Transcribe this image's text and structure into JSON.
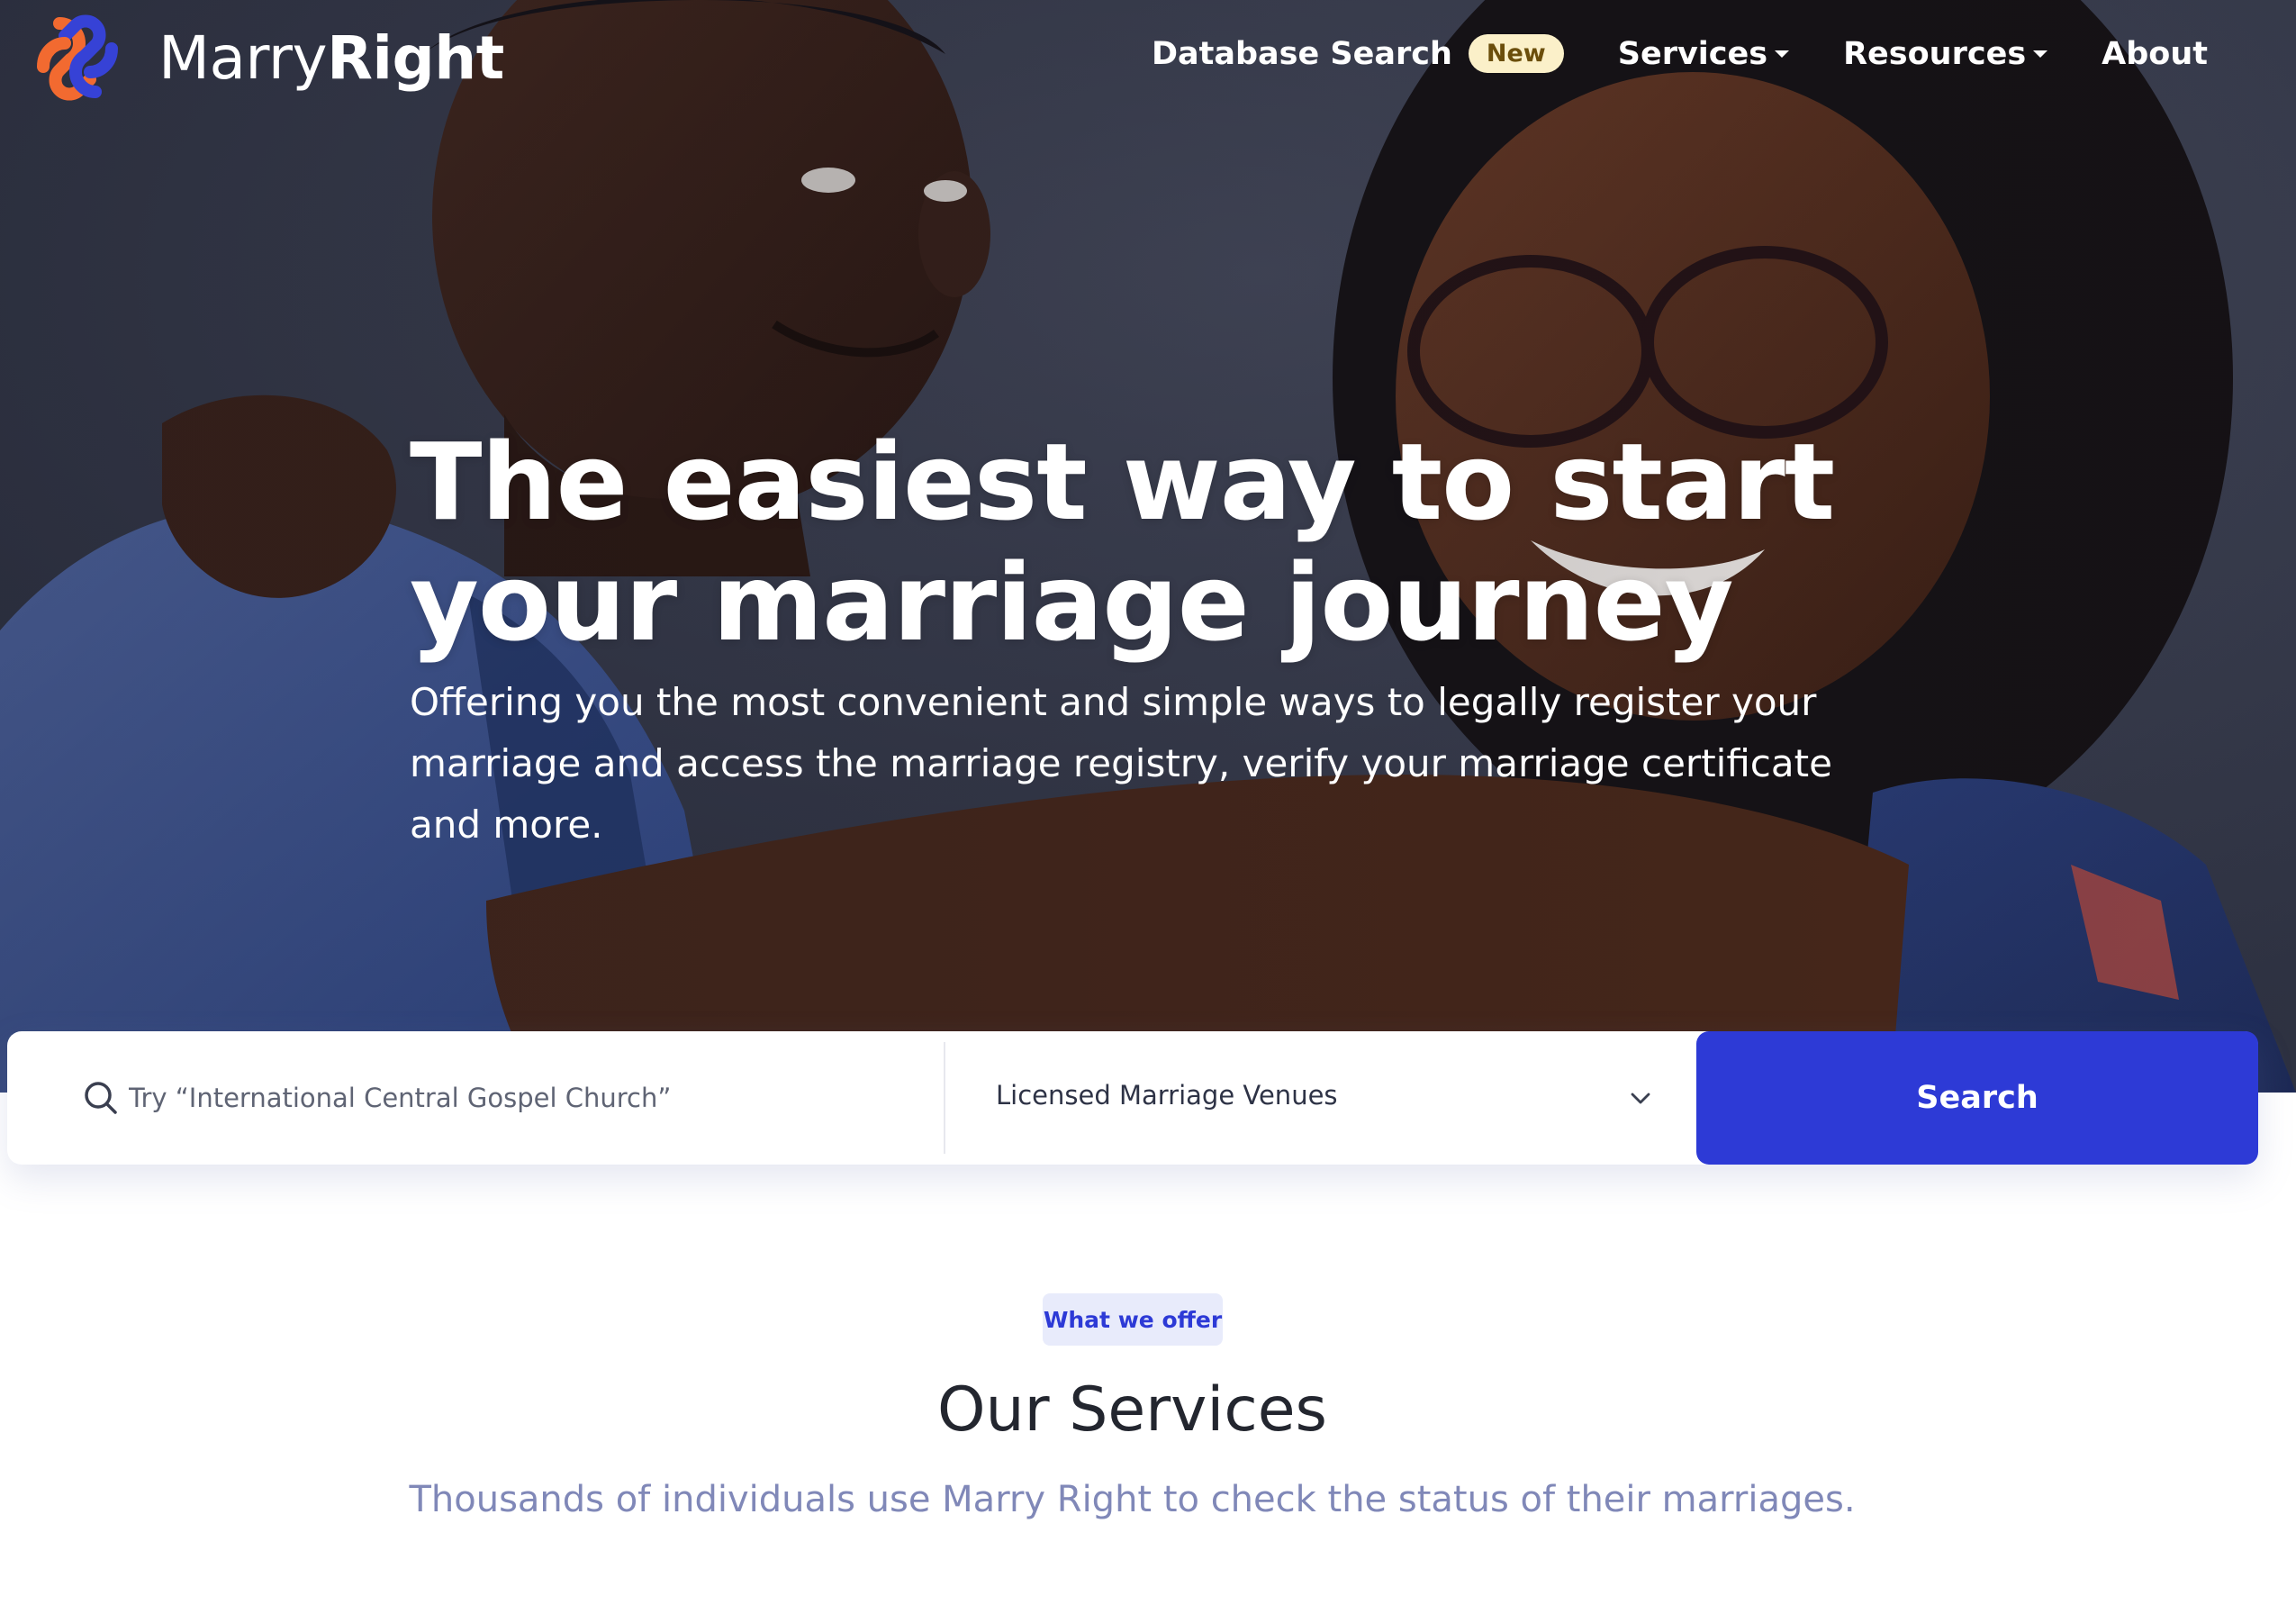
{
  "brand": {
    "name_light": "Marry",
    "name_bold": "Right"
  },
  "nav": {
    "items": [
      {
        "label": "Database Search",
        "badge": "New"
      },
      {
        "label": "Services"
      },
      {
        "label": "Resources"
      },
      {
        "label": "About"
      }
    ]
  },
  "hero": {
    "headline_line1": "The easiest way to start",
    "headline_line2": "your marriage journey",
    "subtext": "Offering you the most convenient and simple ways to legally register your marriage and access the marriage registry, verify your marriage certificate and more."
  },
  "search": {
    "placeholder": "Try “International Central Gospel Church”",
    "category_selected": "Licensed Marriage Venues",
    "button_label": "Search",
    "search_icon": "search-icon",
    "dropdown_icon": "chevron-down-icon"
  },
  "services": {
    "eyebrow": "What we offer",
    "title": "Our Services",
    "subtitle": "Thousands of individuals use Marry Right to check the status of their marriages."
  },
  "colors": {
    "primary": "#2d3ad6",
    "logo_orange": "#f26a30",
    "logo_blue": "#3642d6",
    "badge_bg": "#fbf0c9",
    "pill_bg": "#e8ebfb",
    "subtitle_text": "#8088b8"
  }
}
